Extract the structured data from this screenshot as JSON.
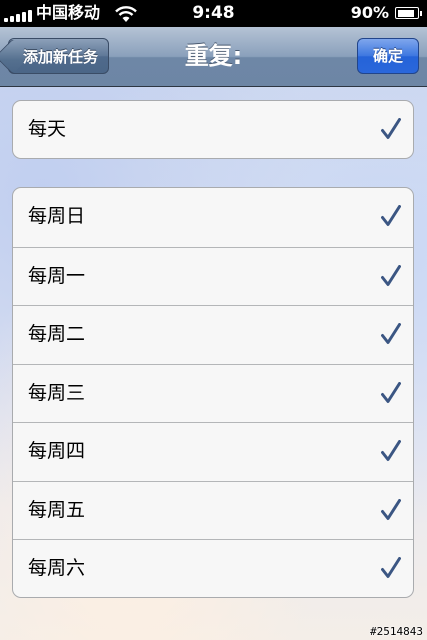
{
  "status_bar": {
    "carrier": "中国移动",
    "time": "9:48",
    "battery": "90%",
    "battery_level": 0.9
  },
  "nav": {
    "back_label": "添加新任务",
    "title": "重复:",
    "confirm_label": "确定"
  },
  "daily": {
    "label": "每天",
    "checked": true,
    "check_icon": "checkmark-icon"
  },
  "weekdays": [
    {
      "label": "每周日",
      "checked": true
    },
    {
      "label": "每周一",
      "checked": true
    },
    {
      "label": "每周二",
      "checked": true
    },
    {
      "label": "每周三",
      "checked": true
    },
    {
      "label": "每周四",
      "checked": true
    },
    {
      "label": "每周五",
      "checked": true
    },
    {
      "label": "每周六",
      "checked": true
    }
  ],
  "watermark": "#2514843",
  "colors": {
    "check": "#3b5683",
    "confirm_button": "#2a67db",
    "nav_bar": "#8aa0bb"
  }
}
